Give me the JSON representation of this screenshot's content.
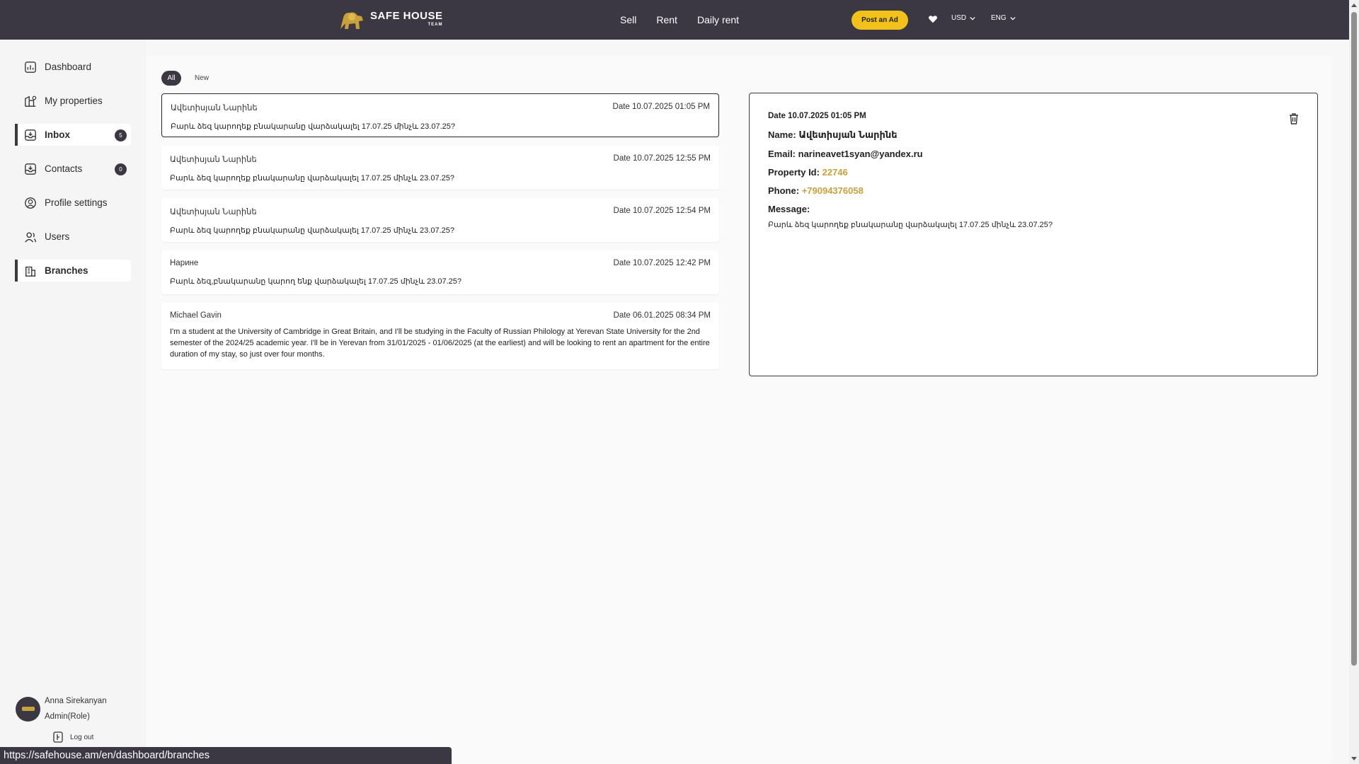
{
  "header": {
    "logo_text": "SAFE HOUSE",
    "logo_sub": "TEAM",
    "nav": [
      "Sell",
      "Rent",
      "Daily rent"
    ],
    "post_ad": "Post an Ad",
    "currency": "USD",
    "language": "ENG"
  },
  "sidebar": {
    "items": [
      {
        "label": "Dashboard"
      },
      {
        "label": "My properties"
      },
      {
        "label": "Inbox",
        "badge": "5"
      },
      {
        "label": "Contacts",
        "badge": "0"
      },
      {
        "label": "Profile settings"
      },
      {
        "label": "Users"
      },
      {
        "label": "Branches"
      }
    ],
    "user": {
      "name": "Anna Sirekanyan",
      "role": "Admin(Role)"
    },
    "logout": "Log out"
  },
  "filters": {
    "all": "All",
    "new": "New"
  },
  "messages": [
    {
      "name": "Ավետիսյան Նարինե",
      "date": "Date 10.07.2025 01:05 PM",
      "text": "Բարև ձեզ կարողեք բնակարանը վարձակալել 17.07.25 մինչև 23.07.25?"
    },
    {
      "name": "Ավետիսյան Նարինե",
      "date": "Date 10.07.2025 12:55 PM",
      "text": "Բարև ձեզ կարողեք բնակարանը վարձակալել 17.07.25 մինչև 23.07.25?"
    },
    {
      "name": "Ավետիսյան Նարինե",
      "date": "Date 10.07.2025 12:54 PM",
      "text": "Բարև ձեզ կարողեք բնակարանը վարձակալել 17.07.25 մինչև 23.07.25?"
    },
    {
      "name": "Нарине",
      "date": "Date 10.07.2025 12:42 PM",
      "text": "Բարև ձեզ,բնակարանը կարող ենք վարձակալել 17.07.25 մինչև 23.07.25?"
    },
    {
      "name": "Michael Gavin",
      "date": "Date 06.01.2025 08:34 PM",
      "text": "I'm a student at the University of Cambridge in Great Britain, and I'll be studying in the Faculty of Russian Philology at Yerevan State University for the 2nd semester of the 2024/25 academic year. I'll be in Yerevan from 31/01/2025 - 01/06/2025 (at the earliest) and will be looking to rent an apartment for the entire duration of my stay, so just over four months."
    }
  ],
  "detail": {
    "date": "Date 10.07.2025 01:05 PM",
    "name_label": "Name:",
    "name": "Ավետիսյան Նարինե",
    "email_label": "Email:",
    "email": "narineavet1syan@yandex.ru",
    "property_label": "Property Id:",
    "property_id": "22746",
    "phone_label": "Phone:",
    "phone": "+79094376058",
    "message_label": "Message:",
    "message": "Բարև ձեզ կարողեք բնակարանը վարձակալել 17.07.25 մինչև 23.07.25?"
  },
  "status_url": "https://safehouse.am/en/dashboard/branches",
  "colors": {
    "header_bg": "#3b3743",
    "accent": "#f2c21a",
    "gold": "#c9a13c"
  }
}
